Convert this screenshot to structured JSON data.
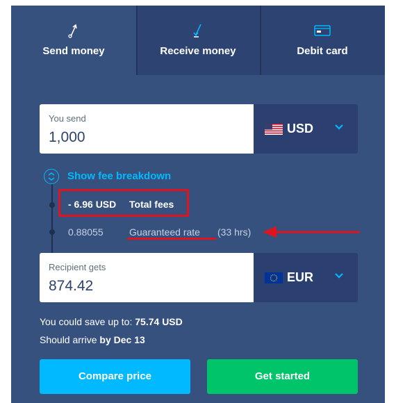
{
  "tabs": [
    {
      "label": "Send money",
      "icon": "send-arrow-icon"
    },
    {
      "label": "Receive money",
      "icon": "receive-arrow-icon"
    },
    {
      "label": "Debit card",
      "icon": "card-icon"
    }
  ],
  "send": {
    "label": "You send",
    "value": "1,000",
    "currency": "USD",
    "flag": "us-flag-icon"
  },
  "fees": {
    "toggle_label": "Show fee breakdown",
    "total_amount": "- 6.96 USD",
    "total_label": "Total fees",
    "rate_value": "0.88055",
    "rate_label": "Guaranteed rate",
    "rate_hours": "(33 hrs)"
  },
  "receive": {
    "label": "Recipient gets",
    "value": "874.42",
    "currency": "EUR",
    "flag": "eu-flag-icon"
  },
  "savings": {
    "prefix": "You could save up to:",
    "amount": "75.74 USD"
  },
  "arrival": {
    "prefix": "Should arrive",
    "date": "by Dec 13"
  },
  "buttons": {
    "compare": "Compare price",
    "start": "Get started"
  },
  "colors": {
    "panel": "#37517e",
    "accent": "#00b9ff",
    "primary": "#00c46a",
    "annotation": "#e0141e"
  }
}
